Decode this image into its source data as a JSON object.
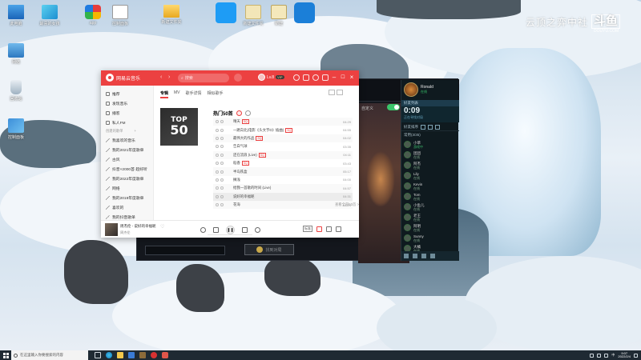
{
  "desktop": {
    "icons": [
      {
        "id": "pc",
        "label": "此电脑"
      },
      {
        "id": "girl",
        "label": "最喜的女孩"
      },
      {
        "id": "app1",
        "label": "app"
      },
      {
        "id": "app2",
        "label": "控制面板"
      },
      {
        "id": "folder",
        "label": "新建文件夹"
      },
      {
        "id": "app3",
        "label": ""
      },
      {
        "id": "app4",
        "label": "新建文件夹"
      },
      {
        "id": "app5",
        "label": "新建"
      },
      {
        "id": "app6",
        "label": ""
      },
      {
        "id": "net",
        "label": "网络"
      },
      {
        "id": "bin",
        "label": "回收站"
      },
      {
        "id": "ctl",
        "label": "控制面板"
      }
    ]
  },
  "watermark": {
    "text": "云顶之弈中社",
    "logo": "斗鱼",
    "sub": "DOUYU.COM"
  },
  "music": {
    "app_title": "网易云音乐",
    "search_placeholder": "搜索",
    "user_level": "Lv.8",
    "vip_badge": "VIP",
    "sidebar": [
      {
        "label": "推荐",
        "active": false
      },
      {
        "label": "发现音乐",
        "active": false
      },
      {
        "label": "播客",
        "active": false
      },
      {
        "label": "私人FM",
        "active": false
      }
    ],
    "sidebar_section": "创建的歌单",
    "sidebar_playlists": [
      "我喜欢的音乐",
      "我的2021年度歌单",
      "古风",
      "抖音×2000首·超好听",
      "我的2022年度歌单",
      "网络",
      "我的2019年度歌单",
      "喜欢的",
      "我的抖音歌单"
    ],
    "tabs": [
      {
        "label": "专辑",
        "active": true
      },
      {
        "label": "MV",
        "active": false
      },
      {
        "label": "歌手详情",
        "active": false
      },
      {
        "label": "相似歌手",
        "active": false
      }
    ],
    "album_top": "TOP",
    "album_num": "50",
    "chart_title": "热门50首",
    "tracks": [
      {
        "title": "晴天",
        "tag": "SQ",
        "duration": "04:29",
        "current": false
      },
      {
        "title": "一路向北(电影《头文字D》插曲)",
        "tag": "SQ",
        "duration": "04:55",
        "current": false
      },
      {
        "title": "最伟大的作品",
        "tag": "SQ",
        "duration": "04:02",
        "current": false
      },
      {
        "title": "告白气球",
        "tag": "",
        "duration": "03:35",
        "current": false
      },
      {
        "title": "还在流浪 (Live)",
        "tag": "SQ",
        "duration": "04:11",
        "current": false
      },
      {
        "title": "稻香",
        "tag": "SQ",
        "duration": "03:43",
        "current": false
      },
      {
        "title": "半岛铁盒",
        "tag": "",
        "duration": "05:17",
        "current": false
      },
      {
        "title": "搁浅",
        "tag": "",
        "duration": "04:00",
        "current": false
      },
      {
        "title": "给我一首歌的时间 (Live)",
        "tag": "",
        "duration": "04:57",
        "current": false
      },
      {
        "title": "说好的幸福呢",
        "tag": "",
        "duration": "04:31",
        "current": true
      },
      {
        "title": "花海",
        "tag": "",
        "duration": "04:24",
        "current": false
      }
    ],
    "view_all": "查看全部50首 >",
    "player": {
      "song": "周杰伦 - 说好的幸福呢",
      "artist": "周杰伦",
      "quality": "标准"
    }
  },
  "game": {
    "mode_label": "自定义",
    "confirm_label": "找到对局",
    "profile_name": "Ronald",
    "profile_status": "在线",
    "friend_header": "好友列表",
    "queue_timer": "0:09",
    "queue_sub": "正在寻找对局",
    "social_label": "好友排序",
    "group_label": "常用(3/35)",
    "friends": [
      {
        "name": "小草",
        "status": "游戏中",
        "ingame": true
      },
      {
        "name": "团团",
        "status": "在线",
        "ingame": false
      },
      {
        "name": "阿杰",
        "status": "在线",
        "ingame": false
      },
      {
        "name": "Lily",
        "status": "在线",
        "ingame": false
      },
      {
        "name": "Kevin",
        "status": "在线",
        "ingame": false
      },
      {
        "name": "Tom",
        "status": "在线",
        "ingame": false
      },
      {
        "name": "小鱼儿",
        "status": "在线",
        "ingame": false
      },
      {
        "name": "老王",
        "status": "在线",
        "ingame": false
      },
      {
        "name": "阿明",
        "status": "在线",
        "ingame": false
      },
      {
        "name": "Sunny",
        "status": "在线",
        "ingame": false
      },
      {
        "name": "大橘",
        "status": "在线",
        "ingame": false
      }
    ]
  },
  "taskbar": {
    "search_placeholder": "在这里输入你要搜索的内容",
    "time": "9:07",
    "date": "2022/2/4",
    "lang": "中"
  }
}
